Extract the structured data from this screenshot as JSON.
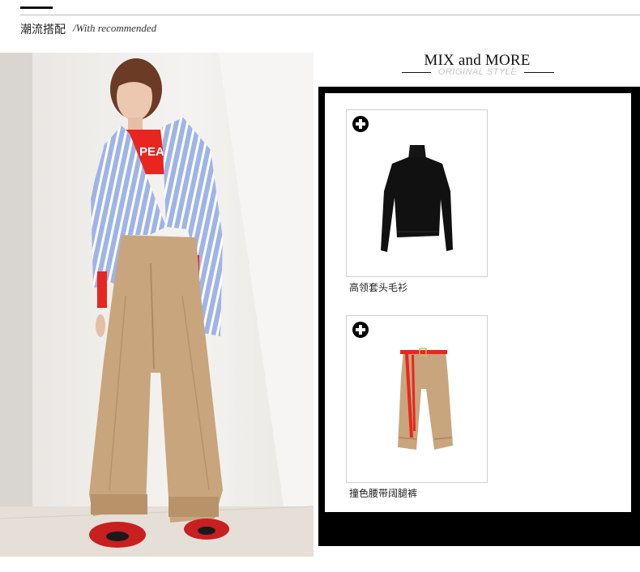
{
  "section": {
    "title": "潮流搭配",
    "subtitle": "/With recommended"
  },
  "mix": {
    "title": "MIX and MORE",
    "subtitle": "ORIGINAL STYLE"
  },
  "photo": {
    "shirt_text": "PEACE"
  },
  "products": [
    {
      "label": "高领套头毛衫",
      "icon": "plus-circle-icon",
      "image": "black-turtleneck-sweater"
    },
    {
      "label": "撞色腰带阔腿裤",
      "icon": "plus-circle-icon",
      "image": "khaki-wide-leg-pants-red-belt"
    }
  ],
  "colors": {
    "frame": "#000000",
    "pants": "#c8a57c",
    "shirt": "#9fb4e6",
    "accent_red": "#e8261f"
  }
}
